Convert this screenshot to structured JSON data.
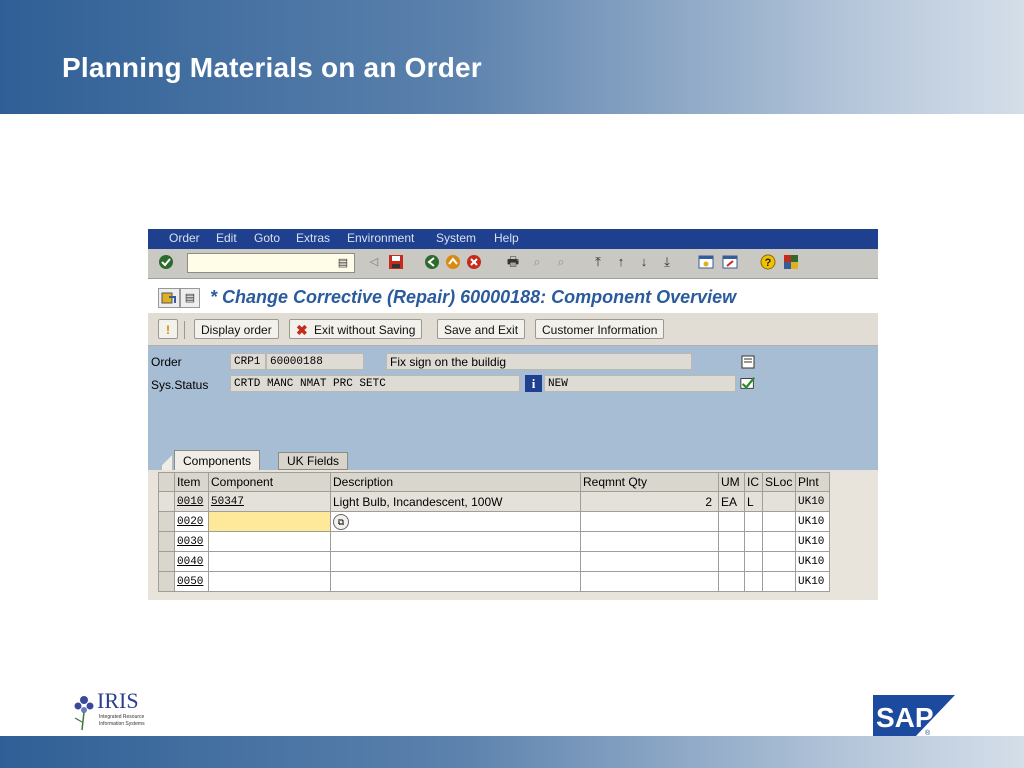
{
  "slide": {
    "title": "Planning Materials on an Order"
  },
  "menu": [
    "Order",
    "Edit",
    "Goto",
    "Extras",
    "Environment",
    "System",
    "Help"
  ],
  "screen": {
    "title": "* Change Corrective (Repair) 60000188: Component Overview"
  },
  "app_toolbar": {
    "display_order": "Display order",
    "exit_without_saving": "Exit without Saving",
    "save_and_exit": "Save and Exit",
    "customer_information": "Customer Information"
  },
  "header": {
    "order_label": "Order",
    "order_type": "CRP1",
    "order_number": "60000188",
    "order_text": "Fix sign on the buildig",
    "status_label": "Sys.Status",
    "system_status": "CRTD MANC NMAT PRC  SETC",
    "user_status": "NEW"
  },
  "tabs": [
    "Components",
    "UK Fields"
  ],
  "table": {
    "columns": [
      "Item",
      "Component",
      "Description",
      "Reqmnt Qty",
      "UM",
      "IC",
      "SLoc",
      "Plnt"
    ],
    "rows": [
      {
        "item": "0010",
        "component": "50347",
        "description": "Light Bulb, Incandescent, 100W",
        "qty": "2",
        "um": "EA",
        "ic": "L",
        "sloc": "",
        "plnt": "UK10"
      },
      {
        "item": "0020",
        "component": "",
        "description": "",
        "qty": "",
        "um": "",
        "ic": "",
        "sloc": "",
        "plnt": "UK10"
      },
      {
        "item": "0030",
        "component": "",
        "description": "",
        "qty": "",
        "um": "",
        "ic": "",
        "sloc": "",
        "plnt": "UK10"
      },
      {
        "item": "0040",
        "component": "",
        "description": "",
        "qty": "",
        "um": "",
        "ic": "",
        "sloc": "",
        "plnt": "UK10"
      },
      {
        "item": "0050",
        "component": "",
        "description": "",
        "qty": "",
        "um": "",
        "ic": "",
        "sloc": "",
        "plnt": "UK10"
      }
    ]
  },
  "logos": {
    "iris_name": "IRIS",
    "iris_tagline_1": "Integrated Resource",
    "iris_tagline_2": "Information Systems",
    "sap": "SAP"
  },
  "colors": {
    "header_blue": "#2f5f96",
    "sap_title_blue": "#2a5b9c",
    "menubar": "#1f3f8f",
    "status_area": "#a7bdd3",
    "active_cell": "#fee89a"
  }
}
